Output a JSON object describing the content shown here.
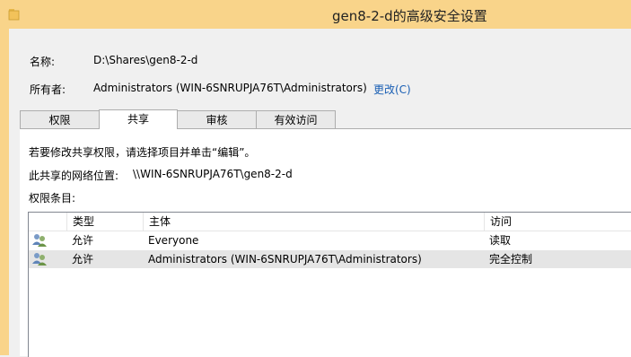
{
  "window": {
    "title": "gen8-2-d的高级安全设置"
  },
  "fields": {
    "name_label": "名称:",
    "name_value": "D:\\Shares\\gen8-2-d",
    "owner_label": "所有者:",
    "owner_value": "Administrators (WIN-6SNRUPJA76T\\Administrators)",
    "owner_change_link": "更改(C)"
  },
  "tabs": [
    {
      "label": "权限"
    },
    {
      "label": "共享"
    },
    {
      "label": "审核"
    },
    {
      "label": "有效访问"
    }
  ],
  "active_tab": "共享",
  "share_panel": {
    "instruction": "若要修改共享权限，请选择项目并单击“编辑”。",
    "location_label": "此共享的网络位置:",
    "location_value": "\\\\WIN-6SNRUPJA76T\\gen8-2-d",
    "entries_label": "权限条目:"
  },
  "permission_list": {
    "columns": [
      "类型",
      "主体",
      "访问"
    ],
    "rows": [
      {
        "icon": "users-icon",
        "type": "允许",
        "principal": "Everyone",
        "access": "读取"
      },
      {
        "icon": "users-icon",
        "type": "允许",
        "principal": "Administrators (WIN-6SNRUPJA76T\\Administrators)",
        "access": "完全控制"
      }
    ]
  },
  "colors": {
    "titlebar": "#f9d48a",
    "link": "#1a5fb4",
    "selected_row": "#e5e5e5"
  }
}
